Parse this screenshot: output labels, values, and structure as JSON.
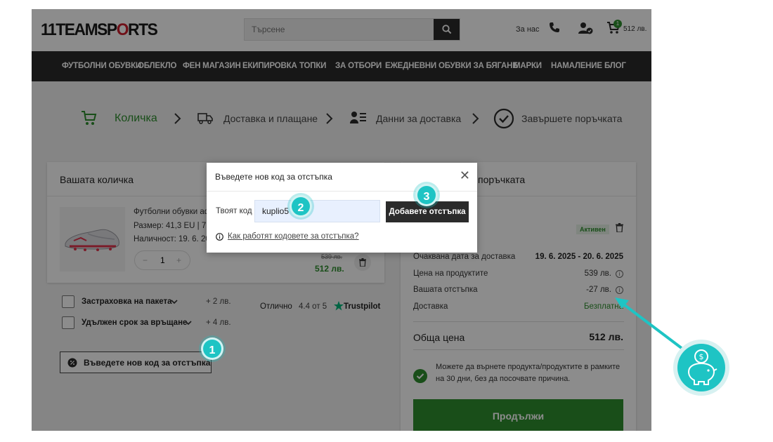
{
  "header": {
    "logo_prefix": "11TEAMSP",
    "logo_mid": "O",
    "logo_suffix": "RTS",
    "search_placeholder": "Търсене",
    "about_label": "За нас",
    "cart_count": "1",
    "cart_total": "512 лв."
  },
  "nav": {
    "items": [
      "ФУТБОЛНИ ОБУВКИ",
      "ОБЛЕКЛО",
      "ФЕН МАГАЗИН",
      "ЕКИПИРОВКА",
      "ТОПКИ",
      "ЗА ОТБОРИ",
      "ЕЖЕДНЕВНИ",
      "ОБУВКИ ЗА БЯГАНЕ",
      "МАРКИ",
      "НАМАЛЕНИЕ",
      "БЛОГ"
    ]
  },
  "steps": {
    "cart": "Количка",
    "delivery": "Доставка и плащане",
    "data": "Данни за доставка",
    "finish": "Завършете поръчката"
  },
  "cart": {
    "title": "Вашата количка",
    "product_name": "Футболни обувки ad",
    "product_size": "Размер: 41,3 EU | 7,5",
    "product_stock": "Наличност:  19. 6. 20",
    "qty_minus": "−",
    "qty_value": "1",
    "qty_plus": "+",
    "old_price": "539 лв.",
    "new_price": "512 лв."
  },
  "options": {
    "insurance_label": "Застраховка на пакета",
    "insurance_price": "+ 2 лв.",
    "return_label": "Удължен срок за връщане",
    "return_price": "+ 4 лв."
  },
  "trust": {
    "text": "Отлично",
    "rating": "4.4 от 5",
    "brand": "Trustpilot"
  },
  "coupon": {
    "button_label": "Въведете нов код за отстъпка"
  },
  "summary": {
    "title_suffix": "поръчката",
    "active_badge": "Активен",
    "delivery_date_label": "Очаквана дата за доставка",
    "delivery_date_value": "19. 6. 2025 - 20. 6. 2025",
    "products_price_label": "Цена на продуктите",
    "products_price_value": "539 лв.",
    "discount_label": "Вашата отстъпка",
    "discount_value": "-27 лв.",
    "shipping_label": "Доставка",
    "shipping_value": "Безплатна",
    "total_label": "Обща цена",
    "total_value": "512 лв.",
    "return_text": "Можете да върнете продукта/продуктите в рамките на 30 дни, без да посочвате причина.",
    "continue_label": "Продължи"
  },
  "modal": {
    "title": "Въведете нов код за отстъпка",
    "code_label": "Твоят код",
    "code_value": "kuplio5",
    "add_button": "Добавете отстъпка",
    "how_link": "Как работят кодовете за отстъпка?"
  },
  "annotations": {
    "step1": "1",
    "step2": "2",
    "step3": "3",
    "accent": "#1ec4c4"
  },
  "colors": {
    "green": "#2f8f2f",
    "dark": "#2a2a2a",
    "logo_red": "#cc1f2f"
  }
}
